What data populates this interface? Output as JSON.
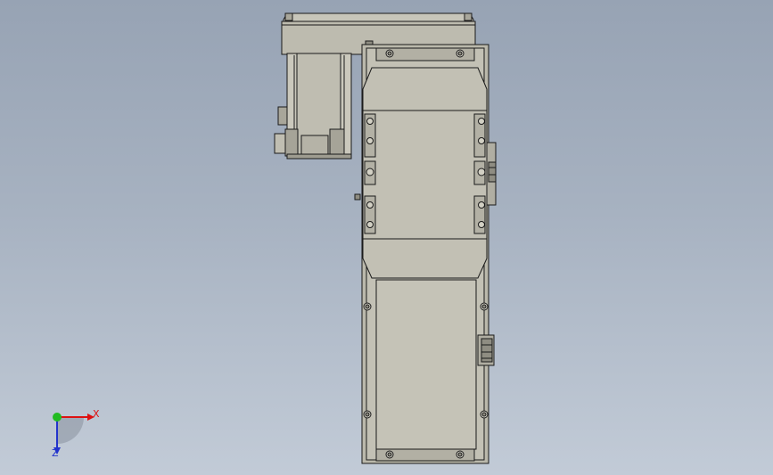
{
  "viewport": {
    "background_top": "#97a3b4",
    "background_bottom": "#c2cbd7",
    "model_fill": "#b8b6a9",
    "model_fill_light": "#c7c5b8",
    "model_edge": "#1a1a1a"
  },
  "triad": {
    "x_label": "X",
    "z_label": "Z",
    "x_color": "#dd1111",
    "y_color": "#22bb22",
    "z_color": "#2233cc"
  }
}
